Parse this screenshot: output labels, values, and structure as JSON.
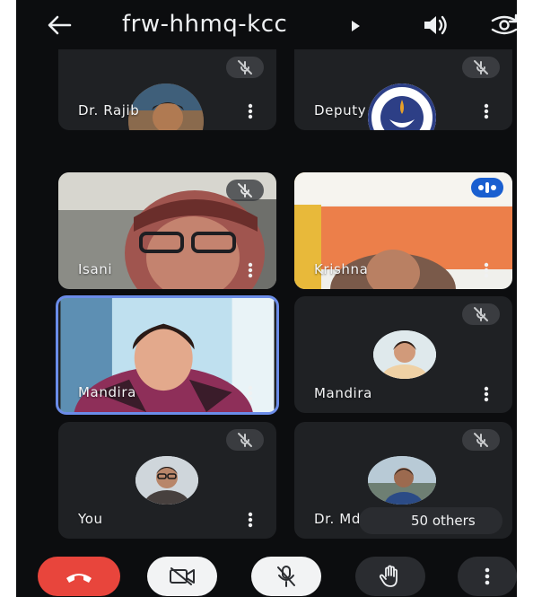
{
  "header": {
    "meeting_code": "frw-hhmq-kcc",
    "back_icon": "arrow-left-icon",
    "caret_icon": "caret-right-icon",
    "audio_icon": "speaker-icon",
    "switch_camera_icon": "camera-switch-icon"
  },
  "participants": [
    {
      "name": "Dr. Rajib",
      "muted": true,
      "tile": "avatar"
    },
    {
      "name": "Deputy",
      "muted": true,
      "tile": "avatar"
    },
    {
      "name": "Isani",
      "muted": true,
      "tile": "video"
    },
    {
      "name": "Krishna",
      "muted": false,
      "speaking": true,
      "tile": "video"
    },
    {
      "name": "Mandira",
      "muted": false,
      "active": true,
      "tile": "video"
    },
    {
      "name": "Mandira",
      "muted": true,
      "tile": "avatar"
    },
    {
      "name": "You",
      "muted": true,
      "tile": "avatar"
    },
    {
      "name": "Dr. Md Z",
      "muted": true,
      "tile": "avatar"
    }
  ],
  "others_chip": "50 others",
  "controls": {
    "end_call_icon": "hangup-icon",
    "camera_icon": "camera-off-icon",
    "mic_icon": "mic-off-icon",
    "hand_icon": "raise-hand-icon",
    "more_icon": "more-vertical-icon"
  },
  "colors": {
    "background": "#0c0d0f",
    "tile": "#1f2124",
    "end_call": "#e8453c",
    "active_border": "#6b8ce8",
    "speaking_badge": "#1a5fd0"
  }
}
